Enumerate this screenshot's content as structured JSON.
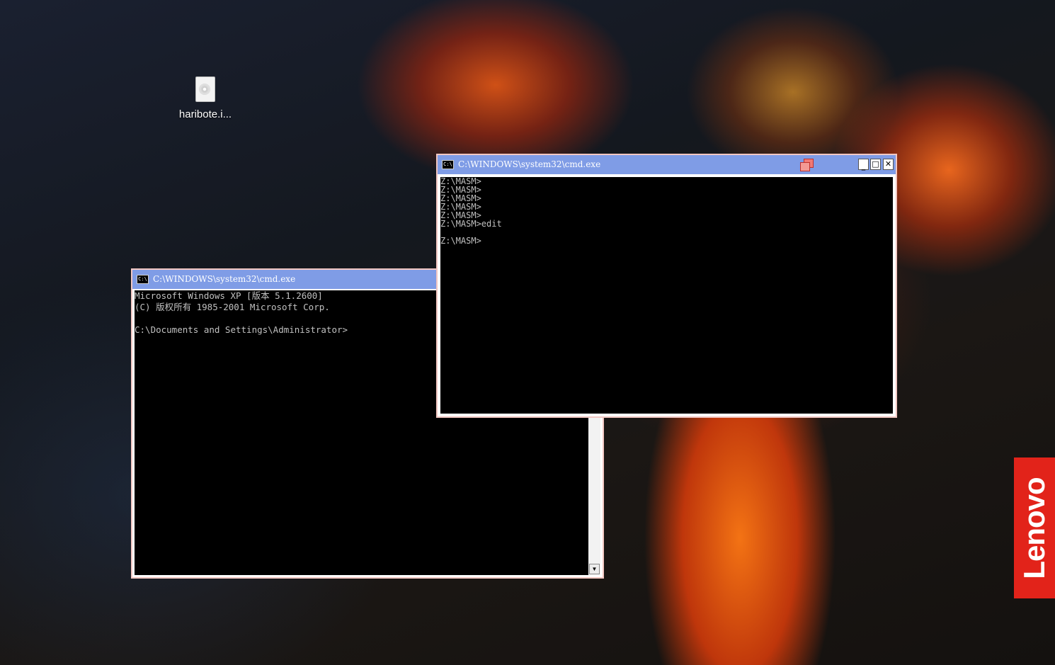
{
  "desktop": {
    "icons": [
      {
        "label": "haribote.i...",
        "icon": "disc-image-file-icon"
      }
    ],
    "brand": "Lenovo"
  },
  "windows": [
    {
      "id": "cmd-back",
      "title": "C:\\WINDOWS\\system32\\cmd.exe",
      "icon": "console-icon",
      "icon_text": "C:\\",
      "console_lines": [
        "Microsoft Windows XP [版本 5.1.2600]",
        "(C) 版权所有 1985-2001 Microsoft Corp.",
        "",
        "C:\\Documents and Settings\\Administrator>"
      ],
      "scrollbar": {
        "down_arrow": "▼"
      }
    },
    {
      "id": "cmd-front",
      "title": "C:\\WINDOWS\\system32\\cmd.exe",
      "icon": "console-icon",
      "icon_text": "C:\\",
      "buttons": {
        "minimize": "_",
        "maximize": "□",
        "close": "✕"
      },
      "console_lines": [
        "Z:\\MASM>",
        "Z:\\MASM>",
        "Z:\\MASM>",
        "Z:\\MASM>",
        "Z:\\MASM>",
        "Z:\\MASM>edit",
        "",
        "Z:\\MASM>"
      ]
    }
  ]
}
